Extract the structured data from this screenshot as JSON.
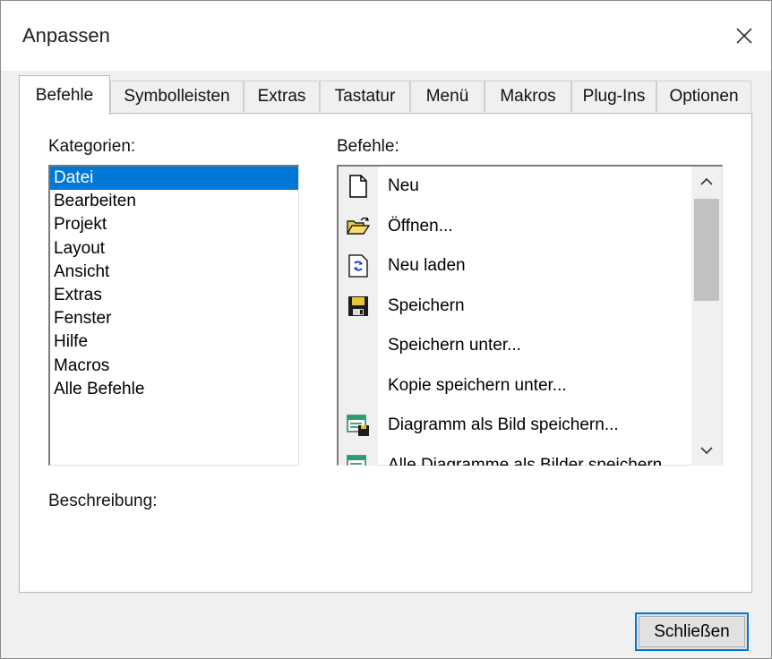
{
  "window": {
    "title": "Anpassen",
    "close_icon": "close-icon"
  },
  "tabs": [
    {
      "label": "Befehle",
      "active": true
    },
    {
      "label": "Symbolleisten",
      "active": false
    },
    {
      "label": "Extras",
      "active": false
    },
    {
      "label": "Tastatur",
      "active": false
    },
    {
      "label": "Menü",
      "active": false
    },
    {
      "label": "Makros",
      "active": false
    },
    {
      "label": "Plug-Ins",
      "active": false
    },
    {
      "label": "Optionen",
      "active": false
    }
  ],
  "categories": {
    "label": "Kategorien:",
    "items": [
      "Datei",
      "Bearbeiten",
      "Projekt",
      "Layout",
      "Ansicht",
      "Extras",
      "Fenster",
      "Hilfe",
      "Macros",
      "Alle Befehle"
    ],
    "selected": "Datei"
  },
  "commands": {
    "label": "Befehle:",
    "items": [
      {
        "label": "Neu",
        "icon": "new-document-icon"
      },
      {
        "label": "Öffnen...",
        "icon": "open-folder-icon"
      },
      {
        "label": "Neu laden",
        "icon": "reload-icon"
      },
      {
        "label": "Speichern",
        "icon": "save-icon"
      },
      {
        "label": "Speichern unter...",
        "icon": ""
      },
      {
        "label": "Kopie speichern unter...",
        "icon": ""
      },
      {
        "label": "Diagramm als Bild speichern...",
        "icon": "save-diagram-image-icon"
      },
      {
        "label": "Alle Diagramme als Bilder speichern...",
        "icon": "save-all-diagrams-icon"
      }
    ]
  },
  "description": {
    "label": "Beschreibung:"
  },
  "footer": {
    "close_label": "Schließen"
  },
  "colors": {
    "selection": "#0078d7",
    "dialog_bg": "#f0f0f0"
  }
}
